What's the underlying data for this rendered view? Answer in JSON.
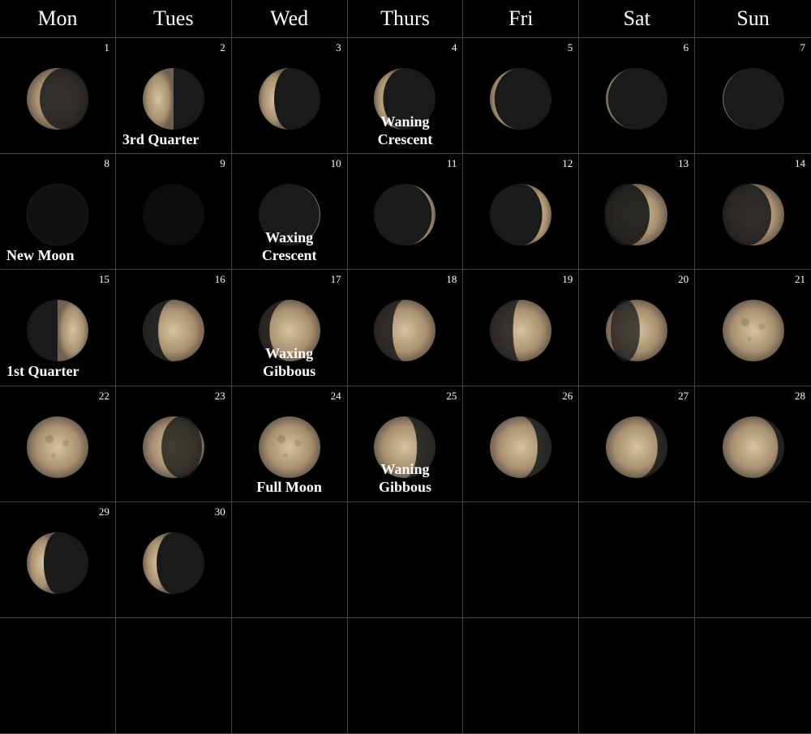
{
  "header": {
    "days": [
      "Mon",
      "Tues",
      "Wed",
      "Thurs",
      "Fri",
      "Sat",
      "Sun"
    ]
  },
  "cells": [
    {
      "day": 1,
      "phase": "waning_crescent_late",
      "label": null,
      "labelPos": null
    },
    {
      "day": 2,
      "phase": "third_quarter",
      "label": "3rd Quarter",
      "labelPos": "bottom-left"
    },
    {
      "day": 3,
      "phase": "waning_crescent_half",
      "label": null,
      "labelPos": null
    },
    {
      "day": 4,
      "phase": "waning_crescent",
      "label": "Waning\nCrescent",
      "labelPos": "bottom-center"
    },
    {
      "day": 5,
      "phase": "waning_crescent_thin",
      "label": null,
      "labelPos": null
    },
    {
      "day": 6,
      "phase": "waning_crescent_thinner",
      "label": null,
      "labelPos": null
    },
    {
      "day": 7,
      "phase": "waning_crescent_thinnest",
      "label": null,
      "labelPos": null
    },
    {
      "day": 8,
      "phase": "new_moon",
      "label": "New Moon",
      "labelPos": "bottom-left"
    },
    {
      "day": 9,
      "phase": "new_moon_dark",
      "label": null,
      "labelPos": null
    },
    {
      "day": 10,
      "phase": "waxing_crescent_thin",
      "label": "Waxing\nCrescent",
      "labelPos": "bottom-center"
    },
    {
      "day": 11,
      "phase": "waxing_crescent",
      "label": null,
      "labelPos": null
    },
    {
      "day": 12,
      "phase": "waxing_crescent_half",
      "label": null,
      "labelPos": null
    },
    {
      "day": 13,
      "phase": "waxing_gibbous_small",
      "label": null,
      "labelPos": null
    },
    {
      "day": 14,
      "phase": "waxing_gibbous_med",
      "label": null,
      "labelPos": null
    },
    {
      "day": 15,
      "phase": "first_quarter",
      "label": "1st Quarter",
      "labelPos": "bottom-left"
    },
    {
      "day": 16,
      "phase": "waxing_gibbous_q",
      "label": null,
      "labelPos": null
    },
    {
      "day": 17,
      "phase": "waxing_gibbous",
      "label": "Waxing\nGibbous",
      "labelPos": "bottom-center"
    },
    {
      "day": 18,
      "phase": "waxing_gibbous_large",
      "label": null,
      "labelPos": null
    },
    {
      "day": 19,
      "phase": "waxing_gibbous_xlarge",
      "label": null,
      "labelPos": null
    },
    {
      "day": 20,
      "phase": "waxing_gibbous_full",
      "label": null,
      "labelPos": null
    },
    {
      "day": 21,
      "phase": "full_moon",
      "label": null,
      "labelPos": null
    },
    {
      "day": 22,
      "phase": "full_moon",
      "label": null,
      "labelPos": null
    },
    {
      "day": 23,
      "phase": "waning_gibbous_large",
      "label": null,
      "labelPos": null
    },
    {
      "day": 24,
      "phase": "full_moon",
      "label": "Full Moon",
      "labelPos": "bottom-center"
    },
    {
      "day": 25,
      "phase": "waning_gibbous",
      "label": "Waning\nGibbous",
      "labelPos": "bottom-center"
    },
    {
      "day": 26,
      "phase": "waning_gibbous_med",
      "label": null,
      "labelPos": null
    },
    {
      "day": 27,
      "phase": "waning_gibbous_small",
      "label": null,
      "labelPos": null
    },
    {
      "day": 28,
      "phase": "waning_gibbous_xsmall",
      "label": null,
      "labelPos": null
    },
    {
      "day": 29,
      "phase": "third_quarter_waning",
      "label": null,
      "labelPos": null
    },
    {
      "day": 30,
      "phase": "waning_crescent_end",
      "label": null,
      "labelPos": null
    },
    {
      "day": null,
      "phase": null,
      "label": null,
      "labelPos": null
    },
    {
      "day": null,
      "phase": null,
      "label": null,
      "labelPos": null
    },
    {
      "day": null,
      "phase": null,
      "label": null,
      "labelPos": null
    },
    {
      "day": null,
      "phase": null,
      "label": null,
      "labelPos": null
    },
    {
      "day": null,
      "phase": null,
      "label": null,
      "labelPos": null
    },
    {
      "day": null,
      "phase": null,
      "label": null,
      "labelPos": null
    },
    {
      "day": null,
      "phase": null,
      "label": null,
      "labelPos": null
    },
    {
      "day": null,
      "phase": null,
      "label": null,
      "labelPos": null
    },
    {
      "day": null,
      "phase": null,
      "label": null,
      "labelPos": null
    },
    {
      "day": null,
      "phase": null,
      "label": null,
      "labelPos": null
    },
    {
      "day": null,
      "phase": null,
      "label": null,
      "labelPos": null
    },
    {
      "day": null,
      "phase": null,
      "label": null,
      "labelPos": null
    }
  ]
}
